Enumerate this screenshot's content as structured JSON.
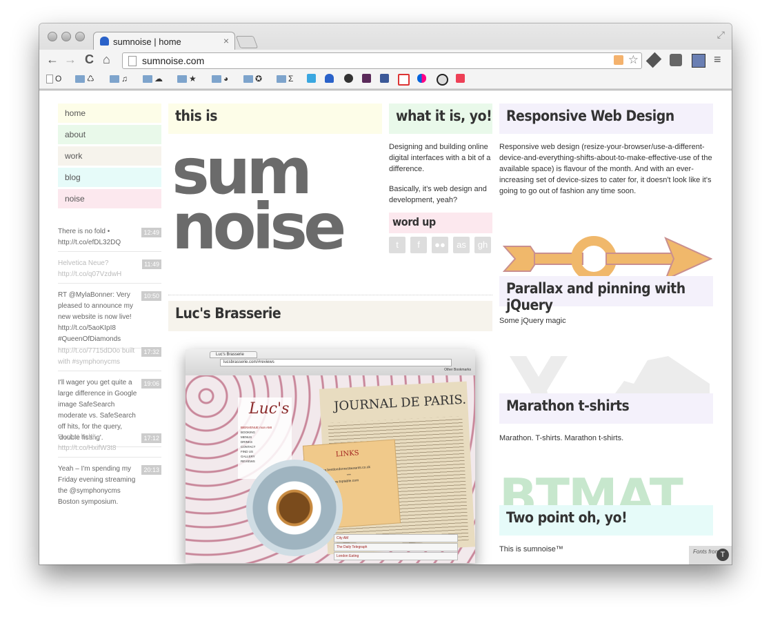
{
  "browser": {
    "tab_title": "sumnoise | home",
    "tab_close": "×",
    "url": "sumnoise.com",
    "back": "←",
    "forward": "→",
    "reload": "C",
    "home": "⌂",
    "fullscreen": "⤢",
    "menu": "≡",
    "star": "☆",
    "bookmarks": [
      "O",
      "♺",
      "♫",
      "☁",
      "★",
      "◕",
      "✪",
      "Σ"
    ]
  },
  "nav": {
    "items": [
      {
        "label": "home",
        "color": "#fdfde8"
      },
      {
        "label": "about",
        "color": "#e9f9ea"
      },
      {
        "label": "work",
        "color": "#f6f3ec"
      },
      {
        "label": "blog",
        "color": "#e6fbf9"
      },
      {
        "label": "noise",
        "color": "#fce8ee"
      }
    ]
  },
  "tweets": [
    {
      "text": "There is no fold • http://t.co/efDL32DQ",
      "time": "12:49"
    },
    {
      "text": "Helvetica Neue? http://t.co/q07VzdwH",
      "time": "11:49"
    },
    {
      "text": "RT @MylaBonner: Very pleased to announce my new website is now live! http://t.co/5aoKIpI8 #QueenOfDiamonds",
      "time": "10:50"
    },
    {
      "text": "http://t.co/7715dD0o built with #symphonycms",
      "time": "17:32"
    },
    {
      "text": "I'll wager you get quite a large difference in Google image SafeSearch moderate vs. SafeSearch off hits, for the query, 'double fisting'.",
      "time": "19:06"
    },
    {
      "text": "Bucket held! • http://t.co/HxifW3t8",
      "time": "17:12"
    },
    {
      "text": "Yeah – I'm spending my Friday evening streaming the @symphonycms Boston symposium.",
      "time": "20:13"
    }
  ],
  "main": {
    "this_is": "this is",
    "logo_line1": "sum",
    "logo_line2": "noise",
    "what_heading": "what it is, yo!",
    "what_p1": "Designing and building online digital interfaces with a bit of a difference.",
    "what_p2": "Basically, it's web design and development, yeah?",
    "wordup_heading": "word up",
    "social_icons": [
      "t",
      "f",
      "●●",
      "as",
      "gh"
    ],
    "luc_heading": "Luc's Brasserie"
  },
  "screenshot": {
    "tab": "Luc's Brasserie",
    "url": "lucsbrasserie.com/#reviews",
    "other_bookmarks": "Other Bookmarks",
    "newspaper_title": "JOURNAL DE PARIS.",
    "logo": "Luc's",
    "menu_items": [
      "BIENVENUE mon AMI",
      "BOOKING",
      "MENUS",
      "DRINKS",
      "CONTACT",
      "FIND US",
      "GALLERY",
      "REVIEWS"
    ],
    "links_title": "LINKS",
    "links": [
      "www.bestlondonrestaurants.co.uk",
      "***",
      "www.toptable.com"
    ],
    "reviews": [
      "City AM",
      "The Daily Telegraph",
      "London Eating"
    ]
  },
  "right": {
    "rwd_heading": "Responsive Web Design",
    "rwd_text": "Responsive web design (resize-your-browser/use-a-different-device-and-everything-shifts-about-to-make-effective-use of the available space) is flavour of the month. And with an ever-increasing set of device-sizes to cater for, it doesn't look like it's going to go out of fashion any time soon.",
    "parallax_heading": "Parallax and pinning with jQuery",
    "parallax_text": "Some jQuery magic",
    "marathon_heading": "Marathon t-shirts",
    "marathon_text": "Marathon. T-shirts. Marathon t-shirts.",
    "btmat": "BTMAT",
    "twopoint_heading": "Two point oh, yo!",
    "twopoint_text": "This is sumnoise™"
  },
  "badge": {
    "text": "Fonts from",
    "logo": "T"
  },
  "colors": {
    "yellow": "#fdfde8",
    "green": "#e9f9ea",
    "beige": "#f6f3ec",
    "cyan": "#e6fbf9",
    "pink": "#fce8ee",
    "lavender": "#f4f1fb",
    "arrow": "#f0b86b"
  }
}
